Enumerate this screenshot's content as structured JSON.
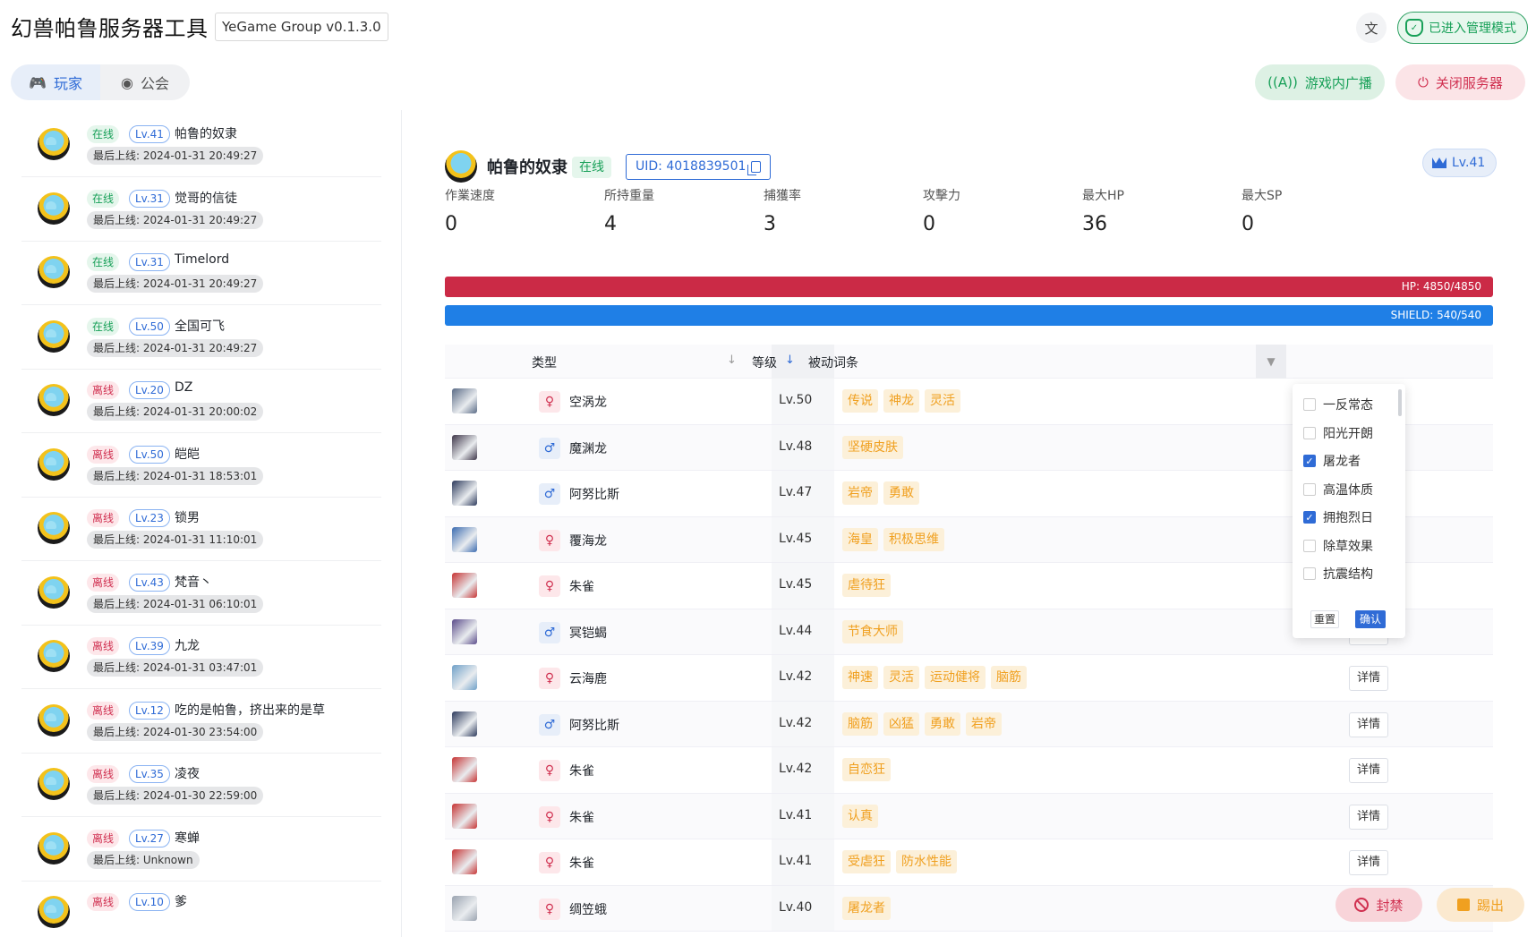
{
  "header": {
    "title": "幻兽帕鲁服务器工具",
    "version": "YeGame Group v0.1.3.0",
    "admin_label": "已进入管理模式",
    "broadcast_label": "游戏内广播",
    "shutdown_label": "关闭服务器"
  },
  "tabs": [
    {
      "label": "玩家",
      "active": true
    },
    {
      "label": "公会",
      "active": false
    }
  ],
  "players": [
    {
      "status": "在线",
      "online": true,
      "level": "Lv.41",
      "name": "帕鲁的奴隶",
      "last_seen": "最后上线: 2024-01-31 20:49:27"
    },
    {
      "status": "在线",
      "online": true,
      "level": "Lv.31",
      "name": "觉哥的信徒",
      "last_seen": "最后上线: 2024-01-31 20:49:27"
    },
    {
      "status": "在线",
      "online": true,
      "level": "Lv.31",
      "name": "Timelord",
      "last_seen": "最后上线: 2024-01-31 20:49:27"
    },
    {
      "status": "在线",
      "online": true,
      "level": "Lv.50",
      "name": "全国可飞",
      "last_seen": "最后上线: 2024-01-31 20:49:27"
    },
    {
      "status": "离线",
      "online": false,
      "level": "Lv.20",
      "name": "DZ",
      "last_seen": "最后上线: 2024-01-31 20:00:02"
    },
    {
      "status": "离线",
      "online": false,
      "level": "Lv.50",
      "name": "皑皑",
      "last_seen": "最后上线: 2024-01-31 18:53:01"
    },
    {
      "status": "离线",
      "online": false,
      "level": "Lv.23",
      "name": "锁男",
      "last_seen": "最后上线: 2024-01-31 11:10:01"
    },
    {
      "status": "离线",
      "online": false,
      "level": "Lv.43",
      "name": "梵音丶",
      "last_seen": "最后上线: 2024-01-31 06:10:01"
    },
    {
      "status": "离线",
      "online": false,
      "level": "Lv.39",
      "name": "九龙",
      "last_seen": "最后上线: 2024-01-31 03:47:01"
    },
    {
      "status": "离线",
      "online": false,
      "level": "Lv.12",
      "name": "吃的是帕鲁，挤出来的是草",
      "last_seen": "最后上线: 2024-01-30 23:54:00"
    },
    {
      "status": "离线",
      "online": false,
      "level": "Lv.35",
      "name": "凌夜",
      "last_seen": "最后上线: 2024-01-30 22:59:00"
    },
    {
      "status": "离线",
      "online": false,
      "level": "Lv.27",
      "name": "寒蝉",
      "last_seen": "最后上线: Unknown"
    },
    {
      "status": "离线",
      "online": false,
      "level": "Lv.10",
      "name": "爹",
      "last_seen": ""
    }
  ],
  "detail": {
    "name": "帕鲁的奴隶",
    "status": "在线",
    "uid": "UID: 4018839501",
    "level": "Lv.41",
    "stats": [
      {
        "label": "作業速度",
        "value": "0"
      },
      {
        "label": "所持重量",
        "value": "4"
      },
      {
        "label": "捕獲率",
        "value": "3"
      },
      {
        "label": "攻擊力",
        "value": "0"
      },
      {
        "label": "最大HP",
        "value": "36"
      },
      {
        "label": "最大SP",
        "value": "0"
      }
    ],
    "hp_text": "HP: 4850/4850",
    "hp_fraction": 1.0,
    "shield_text": "SHIELD: 540/540",
    "shield_fraction": 1.0,
    "colors": {
      "hp": "#cb2a46",
      "shield": "#1f7fe6",
      "online": "#18a058",
      "offline": "#d03050",
      "accent": "#2f6bd6",
      "skill": "#f0a020"
    }
  },
  "table": {
    "headers": {
      "type": "类型",
      "level": "等级",
      "skills": "被动词条"
    },
    "detail_label": "详情",
    "rows": [
      {
        "gender": "♀",
        "female": true,
        "name": "空涡龙",
        "level": "Lv.50",
        "skills": [
          "传说",
          "神龙",
          "灵活"
        ],
        "color": "#5a6b86"
      },
      {
        "gender": "♂",
        "female": false,
        "name": "魔渊龙",
        "level": "Lv.48",
        "skills": [
          "坚硬皮肤"
        ],
        "color": "#3d3548"
      },
      {
        "gender": "♂",
        "female": false,
        "name": "阿努比斯",
        "level": "Lv.47",
        "skills": [
          "岩帝",
          "勇敢"
        ],
        "color": "#2d3a5c"
      },
      {
        "gender": "♀",
        "female": true,
        "name": "覆海龙",
        "level": "Lv.45",
        "skills": [
          "海皇",
          "积极思维"
        ],
        "color": "#3b6bb0"
      },
      {
        "gender": "♀",
        "female": true,
        "name": "朱雀",
        "level": "Lv.45",
        "skills": [
          "虐待狂"
        ],
        "color": "#c73434"
      },
      {
        "gender": "♂",
        "female": false,
        "name": "冥铠蝎",
        "level": "Lv.44",
        "skills": [
          "节食大师"
        ],
        "color": "#5a4b8a"
      },
      {
        "gender": "♀",
        "female": true,
        "name": "云海鹿",
        "level": "Lv.42",
        "skills": [
          "神速",
          "灵活",
          "运动健将",
          "脑筋"
        ],
        "color": "#6fa0c8"
      },
      {
        "gender": "♂",
        "female": false,
        "name": "阿努比斯",
        "level": "Lv.42",
        "skills": [
          "脑筋",
          "凶猛",
          "勇敢",
          "岩帝"
        ],
        "color": "#2d3a5c"
      },
      {
        "gender": "♀",
        "female": true,
        "name": "朱雀",
        "level": "Lv.42",
        "skills": [
          "自恋狂"
        ],
        "color": "#c73434"
      },
      {
        "gender": "♀",
        "female": true,
        "name": "朱雀",
        "level": "Lv.41",
        "skills": [
          "认真"
        ],
        "color": "#c73434"
      },
      {
        "gender": "♀",
        "female": true,
        "name": "朱雀",
        "level": "Lv.41",
        "skills": [
          "受虐狂",
          "防水性能"
        ],
        "color": "#c73434"
      },
      {
        "gender": "♀",
        "female": true,
        "name": "绸笠蛾",
        "level": "Lv.40",
        "skills": [
          "屠龙者"
        ],
        "color": "#9aa3b0"
      }
    ]
  },
  "filter": {
    "options": [
      {
        "label": "一反常态",
        "checked": false
      },
      {
        "label": "阳光开朗",
        "checked": false
      },
      {
        "label": "屠龙者",
        "checked": true
      },
      {
        "label": "高温体质",
        "checked": false
      },
      {
        "label": "拥抱烈日",
        "checked": true
      },
      {
        "label": "除草效果",
        "checked": false
      },
      {
        "label": "抗震结构",
        "checked": false
      }
    ],
    "reset_label": "重置",
    "confirm_label": "确认"
  },
  "actions": {
    "ban_label": "封禁",
    "kick_label": "踢出"
  }
}
